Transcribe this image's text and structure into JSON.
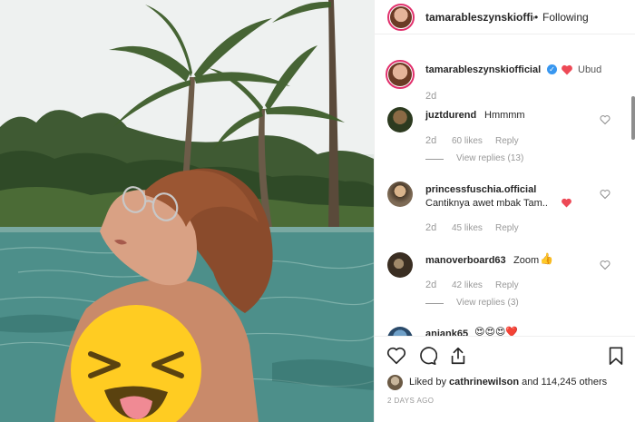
{
  "post": {
    "author": "tamarableszynskiofficial",
    "separator": "•",
    "follow_status": "Following",
    "caption_user": "tamarableszynskiofficial",
    "caption_text": "Ubud",
    "caption_age": "2d",
    "likes_prefix": "Liked by",
    "likes_user": "cathrinewilson",
    "likes_suffix": "and 114,245 others",
    "timestamp": "2 DAYS AGO"
  },
  "comments": [
    {
      "user": "juztdurend",
      "text": "Hmmmm",
      "age": "2d",
      "likes": "60 likes",
      "reply": "Reply",
      "view_replies": "View replies (13)"
    },
    {
      "user": "princessfuschia.official",
      "text": "Cantiknya awet mbak Tam..",
      "age": "2d",
      "likes": "45 likes",
      "reply": "Reply"
    },
    {
      "user": "manoverboard63",
      "text": "Zoom",
      "age": "2d",
      "likes": "42 likes",
      "reply": "Reply",
      "view_replies": "View replies (3)"
    },
    {
      "user": "anjank65",
      "text": ""
    }
  ],
  "colors": {
    "heart_red": "#ed4956",
    "verified_blue": "#3897f0",
    "sticker_yellow": "#ffcc22"
  },
  "icons": {
    "like": "heart-outline-icon",
    "comment": "speech-bubble-icon",
    "share": "share-icon",
    "save": "bookmark-icon"
  }
}
